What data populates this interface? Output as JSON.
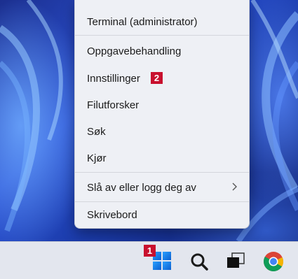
{
  "context_menu": {
    "items": [
      {
        "label": "Terminal (administrator)"
      },
      {
        "label": "Oppgavebehandling"
      },
      {
        "label": "Innstillinger"
      },
      {
        "label": "Filutforsker"
      },
      {
        "label": "Søk"
      },
      {
        "label": "Kjør"
      },
      {
        "label": "Slå av eller logg deg av",
        "has_submenu": true
      },
      {
        "label": "Skrivebord"
      }
    ]
  },
  "annotations": {
    "badge_start": "1",
    "badge_settings": "2",
    "badge_color": "#c8102e"
  },
  "taskbar": {
    "icons": [
      "windows-start-icon",
      "search-icon",
      "task-view-icon",
      "chrome-icon"
    ]
  },
  "colors": {
    "accent_blue": "#0a6cd6",
    "menu_background": "#eef0f5",
    "taskbar_background": "#e3e6ee"
  }
}
